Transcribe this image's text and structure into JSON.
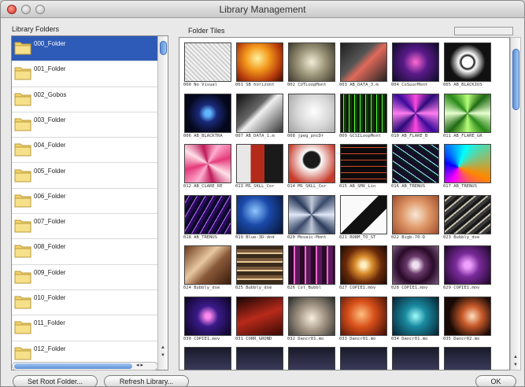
{
  "window": {
    "title": "Library Management"
  },
  "left": {
    "header": "Library Folders",
    "folders": [
      "000_Folder",
      "001_Folder",
      "002_Gobos",
      "003_Folder",
      "004_Folder",
      "005_Folder",
      "006_Folder",
      "007_Folder",
      "008_Folder",
      "009_Folder",
      "010_Folder",
      "011_Folder",
      "012_Folder"
    ],
    "selected_index": 0
  },
  "right": {
    "header": "Folder Tiles",
    "tiles": [
      {
        "caption": "000 No Visual",
        "bg": "repeating-linear-gradient(45deg,#f4f4f4 0 2px,#cfcfcf 2px 4px)"
      },
      {
        "caption": "001 SB horizont",
        "bg": "radial-gradient(circle at 45% 40%,#fff2a0,#f39a1c 35%,#b53a0c 70%,#3a0d05)"
      },
      {
        "caption": "002 CUTLoopMont",
        "bg": "radial-gradient(circle at 50% 50%,#f2edd8,#9e977c 45%,#3f3a2a)"
      },
      {
        "caption": "003 AB_DATA_3.m",
        "bg": "linear-gradient(135deg,#202020,#555 40%,#e06a5a 55%,#222)"
      },
      {
        "caption": "004 CoSuurMont",
        "bg": "radial-gradient(circle at 50% 50%,#ff6ad2,#5a1a8a 40%,#0c0c25)"
      },
      {
        "caption": "005 AB_BLACKIUS",
        "bg": "radial-gradient(circle at 50% 50%,#fff 18%,#111 22%,#fff 30%,#111 60%)"
      },
      {
        "caption": "006 AB_BLACKTRA",
        "bg": "radial-gradient(circle at 50% 50%,#5fb4ff 10%,#1a2a7a 30%,#05071a 70%)"
      },
      {
        "caption": "007 AB_DATA_1.m",
        "bg": "linear-gradient(135deg,#111,#666 40%,#f0f0f0 50%,#333)"
      },
      {
        "caption": "008 jpeg_pncDr",
        "bg": "radial-gradient(circle at 55% 45%,#ffffff,#d8d8d8 50%,#a0a0a0)"
      },
      {
        "caption": "009 GCSILoopMont",
        "bg": "repeating-linear-gradient(90deg,#0a1a05 0 3px,#5cff3a 3px 4px,#123a08 4px 7px)"
      },
      {
        "caption": "010 AB_FLARE_B",
        "bg": "conic-gradient(from 0deg,#ff4ae0,#2b0a7a,#ff7df0,#3a0a9a,#ff4ae0,#2b0a7a,#ff7df0,#3a0a9a,#ff4ae0)"
      },
      {
        "caption": "011 AB_FLARE_GR",
        "bg": "conic-gradient(from 0deg,#b8ff7a,#1f6a12,#e8ffd0,#2a8a18,#b8ff7a,#1f6a12,#e8ffd0,#2a8a18,#b8ff7a)"
      },
      {
        "caption": "012 AB_CLARE_RE",
        "bg": "conic-gradient(from 30deg,#ffb0d0,#e43a7a,#ffe0ea,#c01a5a,#ffb0d0,#e43a7a,#ffe0ea,#c01a5a,#ffb0d0)"
      },
      {
        "caption": "013 MS_SKLL_Cor",
        "bg": "linear-gradient(90deg,#e8e8e8 0 30%,#b42a1a 30% 60%,#1a1a1a 60%)"
      },
      {
        "caption": "014 MS_SKLL_Cor",
        "bg": "radial-gradient(circle at 50% 40%,#1a1a1a 25%,#fafafa 30%,#c83a2a 80%)"
      },
      {
        "caption": "015 AB_SMX_Lin",
        "bg": "repeating-linear-gradient(0deg,#0b0b0b 0 4px,#d84a2a 4px 5px,#0b0b0b 5px 8px)"
      },
      {
        "caption": "016 AB_TRENUS",
        "bg": "repeating-linear-gradient(35deg,#0a1a22 0 4px,#9ff 4px 5px,#1a0a2a 5px 9px)"
      },
      {
        "caption": "017 AB_TRENUS",
        "bg": "conic-gradient(from 200deg at 30% 60%,#f0f,#00f,#0ff,#f80,#f0f)"
      },
      {
        "caption": "018 AB_TRENUS",
        "bg": "repeating-linear-gradient(120deg,#0a0a2a 0 4px,#c070ff 4px 5px,#2a0a5a 5px 9px)"
      },
      {
        "caption": "019 Blue-3D-dnd",
        "bg": "radial-gradient(circle at 40% 40%,#8ec8ff,#1a4aaa 40%,#061230)"
      },
      {
        "caption": "020 Mosaic-Mont",
        "bg": "conic-gradient(from 0deg,#c0c8d8,#3a4a6a,#e0e8f8,#2a3a5a,#c0c8d8,#3a4a6a,#e0e8f8,#2a3a5a,#c0c8d8)"
      },
      {
        "caption": "021 RORM_TO_ST",
        "bg": "linear-gradient(135deg,#fafafa 0 45%,#111 45% 70%,#fafafa 70%)"
      },
      {
        "caption": "022 Bigb-70-D",
        "bg": "radial-gradient(circle at 50% 50%,#f8e8d8,#e09a6a 45%,#a04a2a)"
      },
      {
        "caption": "023 Bubbly_dse",
        "bg": "repeating-linear-gradient(140deg,#1a1a1a 0 4px,#c8c0b0 4px 6px,#3a3a3a 6px 10px)"
      },
      {
        "caption": "024 Bubbly_dse",
        "bg": "linear-gradient(135deg,#6a3a1a,#e8c8a0 40%,#8a5a3a 60%,#3a1a0a)"
      },
      {
        "caption": "025 Bubbly_dse",
        "bg": "repeating-linear-gradient(0deg,#3a2a1a 0 5px,#e8c898 5px 7px,#7a5a3a 7px 11px)"
      },
      {
        "caption": "026 Col_Bubbl",
        "bg": "repeating-linear-gradient(90deg,#2a0a2a 0 6px,#ff6ad0 6px 8px,#5a1a5a 8px 14px)"
      },
      {
        "caption": "027 COPIE1.mov",
        "bg": "radial-gradient(circle at 50% 50%,#fff0c0 8%,#d88a2a 30%,#6a2a0a 60%,#1a0a05)"
      },
      {
        "caption": "028 COPIE1.mov",
        "bg": "radial-gradient(circle at 50% 50%,#f0e0f0 10%,#6a3a6a 30%,#2a0a2a 60%,#7a5a7a)"
      },
      {
        "caption": "029 COPIE1.mov",
        "bg": "radial-gradient(circle at 50% 50%,#f0a0ff 10%,#7a2a9a 40%,#1a0525)"
      },
      {
        "caption": "030 COPIE1.mov",
        "bg": "radial-gradient(circle at 50% 50%,#ff8af0 8%,#3a1a8a 35%,#0a0520)"
      },
      {
        "caption": "031 CORR_GROND",
        "bg": "linear-gradient(160deg,#1a0505,#b82a1a 50%,#3a0a05)"
      },
      {
        "caption": "032 Dancr01.mo",
        "bg": "radial-gradient(circle at 50% 55%,#f8f0e0,#a89a88 40%,#2a2a2a)"
      },
      {
        "caption": "033 Dancr01.mo",
        "bg": "radial-gradient(circle at 45% 45%,#ffc080,#d8501a 40%,#3a0a05)"
      },
      {
        "caption": "034 Dancr01.mo",
        "bg": "radial-gradient(circle at 50% 50%,#a0ffff,#1a8aa0 35%,#052030)"
      },
      {
        "caption": "035 Dancr02.mo",
        "bg": "radial-gradient(circle at 60% 50%,#ffe0c0,#c85a2a 30%,#1a0a05 70%)"
      }
    ]
  },
  "buttons": {
    "set_root": "Set Root Folder...",
    "refresh": "Refresh Library...",
    "ok": "OK"
  }
}
